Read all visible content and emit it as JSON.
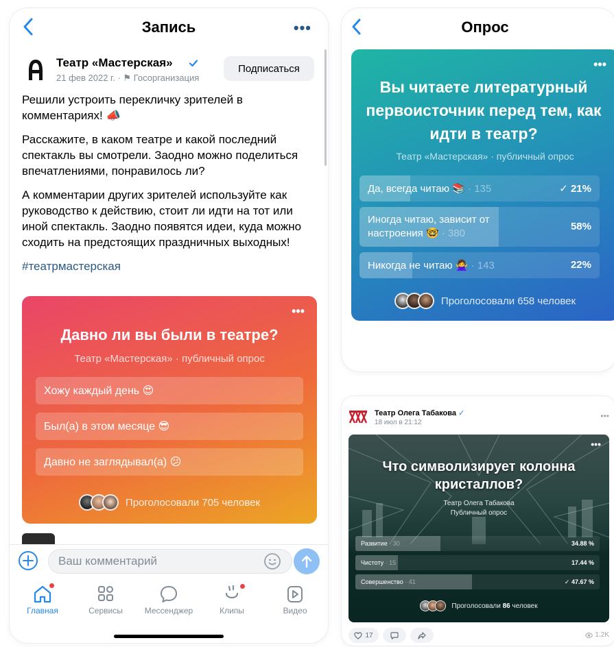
{
  "left": {
    "nav": {
      "title": "Запись",
      "more": "•••"
    },
    "author": {
      "name": "Театр «Мастерская»",
      "date": "21 фев 2022 г.",
      "separator": "·",
      "org": "Госорганизация",
      "subscribe_label": "Подписаться"
    },
    "post": {
      "p1": "Решили устроить перекличку зрителей в комментариях! 📣",
      "p2": "Расскажите, в каком театре и какой последний спектакль вы смотрели. Заодно можно поделиться впечатлениями, понравилось ли?",
      "p3": "А комментарии других зрителей используйте как руководство к действию, стоит ли идти на тот или иной спектакль. Заодно появятся идеи, куда можно сходить на предстоящих праздничных выходных!",
      "hashtag": "#театрмастерская"
    },
    "poll": {
      "more": "•••",
      "question": "Давно ли вы были в театре?",
      "subtitle": "Театр «Мастерская» · публичный опрос",
      "options": [
        {
          "label": "Хожу каждый день 😍"
        },
        {
          "label": "Был(а) в этом месяце 😎"
        },
        {
          "label": "Давно не заглядывал(а) 😕"
        }
      ],
      "voters_text": "Проголосовали 705 человек"
    },
    "comment": {
      "placeholder": "Ваш комментарий"
    },
    "tabs": [
      {
        "label": "Главная",
        "icon": "home-icon",
        "active": true,
        "badge": true
      },
      {
        "label": "Сервисы",
        "icon": "services-icon",
        "active": false,
        "badge": false
      },
      {
        "label": "Мессенджер",
        "icon": "messenger-icon",
        "active": false,
        "badge": false
      },
      {
        "label": "Клипы",
        "icon": "clips-icon",
        "active": false,
        "badge": true
      },
      {
        "label": "Видео",
        "icon": "video-icon",
        "active": false,
        "badge": false
      }
    ],
    "colors": {
      "accent": "#2688eb",
      "link": "#2a5885",
      "badge": "#e64646"
    }
  },
  "right_top": {
    "nav": {
      "title": "Опрос"
    },
    "poll": {
      "more": "•••",
      "question": "Вы читаете литературный первоисточник перед тем, как идти в театр?",
      "subtitle": "Театр «Мастерская» · публичный опрос",
      "options": [
        {
          "label": "Да, всегда читаю 📚",
          "count": "· 135",
          "percent": "21%",
          "fill": 0.21,
          "checked": true
        },
        {
          "label": "Иногда читаю, зависит от настроения 🤓",
          "count": "· 380",
          "percent": "58%",
          "fill": 0.58,
          "checked": false
        },
        {
          "label": "Никогда не читаю 🙅‍♀️",
          "count": "· 143",
          "percent": "22%",
          "fill": 0.22,
          "checked": false
        }
      ],
      "voters_text": "Проголосовали 658 человек"
    }
  },
  "right_bottom": {
    "author": {
      "name": "Театр Олега Табакова",
      "date": "18 июл в 21:12",
      "dots": "•••"
    },
    "poll": {
      "more": "•••",
      "question": "Что символизирует колонна кристаллов?",
      "subtitle_1": "Театр Олега Табакова",
      "subtitle_2": "Публичный опрос",
      "options": [
        {
          "label": "Развитие",
          "count": "· 30",
          "percent": "34.88 %",
          "fill": 0.3488,
          "checked": false
        },
        {
          "label": "Чистоту",
          "count": "· 15",
          "percent": "17.44 %",
          "fill": 0.1744,
          "checked": false
        },
        {
          "label": "Совершенство",
          "count": "· 41",
          "percent": "47.67 %",
          "fill": 0.4767,
          "checked": true
        }
      ],
      "voters_prefix": "Проголосовали",
      "voters_count": "86",
      "voters_suffix": "человек"
    },
    "actions": {
      "likes": "17",
      "views": "1.2K"
    }
  }
}
